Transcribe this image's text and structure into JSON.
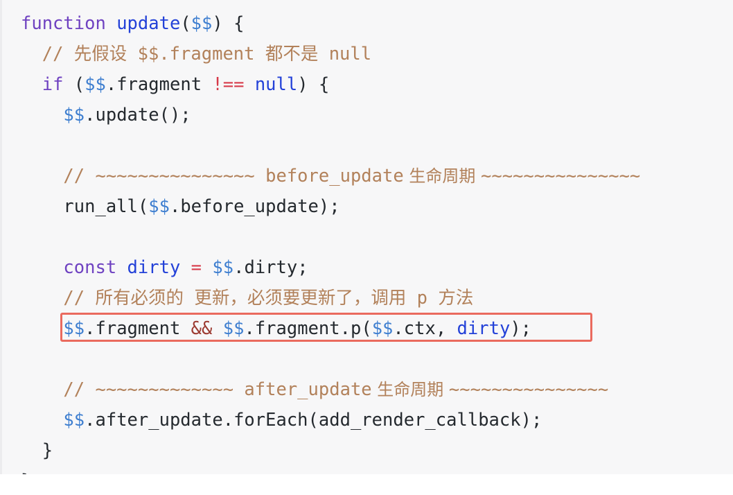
{
  "code_block": {
    "language": "javascript",
    "background_color": "#f7f7f8",
    "highlight_border_color": "#ea6a5e",
    "colors": {
      "keyword": "#6f42c1",
      "function": "#2341d8",
      "variable": "#3f7fd0",
      "plain": "#24292e",
      "literal": "#2341d8",
      "operator": "#d73a49",
      "logical_operator": "#9c3b32",
      "comment": "#b2815a"
    },
    "lines": [
      {
        "id": "l1",
        "text": "function update($$) {"
      },
      {
        "id": "l2",
        "text": "  // 先假设 $$.fragment 都不是 null"
      },
      {
        "id": "l3",
        "text": "  if ($$.fragment !== null) {"
      },
      {
        "id": "l4",
        "text": "    $$.update();"
      },
      {
        "id": "l5",
        "text": ""
      },
      {
        "id": "l6",
        "text": "    // ~~~~~~~~~~~~~~~ before_update 生命周期 ~~~~~~~~~~~~~~~"
      },
      {
        "id": "l7",
        "text": "    run_all($$.before_update);"
      },
      {
        "id": "l8",
        "text": ""
      },
      {
        "id": "l9",
        "text": "    const dirty = $$.dirty;"
      },
      {
        "id": "l10",
        "text": "    // 所有必须的 更新，必须要更新了，调用 p 方法"
      },
      {
        "id": "l11",
        "text": "    $$.fragment && $$.fragment.p($$.ctx, dirty);",
        "highlighted": true
      },
      {
        "id": "l12",
        "text": ""
      },
      {
        "id": "l13",
        "text": "    // ~~~~~~~~~~~~~ after_update 生命周期 ~~~~~~~~~~~~~~~"
      },
      {
        "id": "l14",
        "text": "    $$.after_update.forEach(add_render_callback);"
      },
      {
        "id": "l15",
        "text": "  }"
      },
      {
        "id": "l16",
        "text": "}"
      }
    ],
    "tokens": {
      "kw_function": "function",
      "fn_update": "update",
      "var_dd": "$$",
      "kw_if": "if",
      "prop_fragment": ".fragment",
      "op_strict_neq": "!==",
      "lit_null": "null",
      "call_update": ".update();",
      "comment_1": "// 先假设 $$.fragment 都不是 null",
      "comment_before_prefix": "// ~~~~~~~~~~~~~~~ ",
      "comment_before_name": "before_update",
      "comment_lifecycle": " 生命周期 ",
      "comment_before_suffix": "~~~~~~~~~~~~~~~",
      "call_run_all": "run_all(",
      "prop_before_update": ".before_update",
      "close_semi": ");",
      "kw_const": "const",
      "id_dirty": "dirty",
      "op_assign": "=",
      "prop_dirty": ".dirty;",
      "comment_2": "// 所有必须的 更新，必须要更新了，调用 p 方法",
      "op_and": "&&",
      "prop_fragment_p": ".fragment.p(",
      "prop_ctx": ".ctx, ",
      "comment_after_prefix": "// ~~~~~~~~~~~~~ ",
      "comment_after_name": "after_update",
      "comment_after_suffix": "~~~~~~~~~~~~~~~",
      "prop_after_update_foreach": ".after_update.forEach(",
      "arg_add_render_callback": "add_render_callback",
      "brace_close_inner": "  }",
      "brace_close_outer": "}"
    }
  }
}
